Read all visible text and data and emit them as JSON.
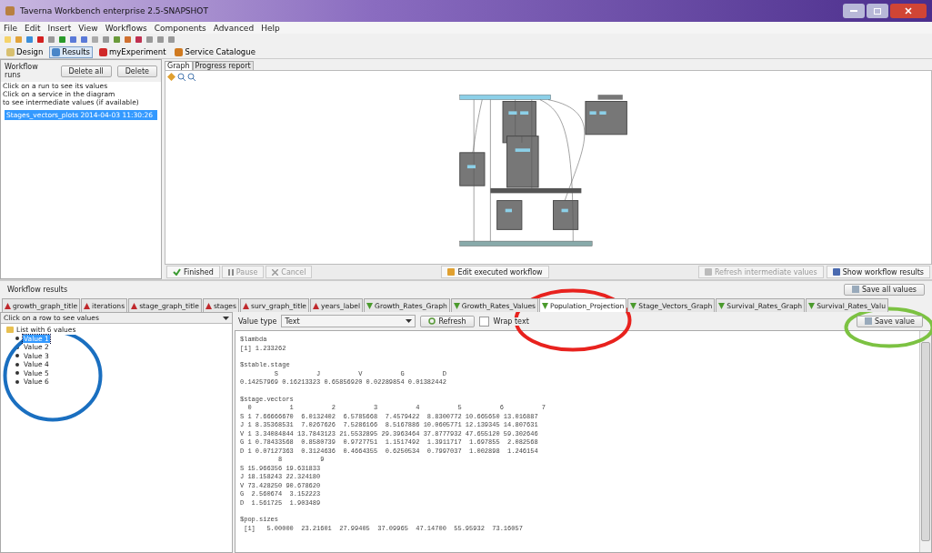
{
  "window": {
    "title": "Taverna Workbench enterprise 2.5-SNAPSHOT"
  },
  "menu": [
    "File",
    "Edit",
    "Insert",
    "View",
    "Workflows",
    "Components",
    "Advanced",
    "Help"
  ],
  "perspectives": [
    {
      "label": "Design",
      "selected": false
    },
    {
      "label": "Results",
      "selected": true
    },
    {
      "label": "myExperiment",
      "selected": false
    },
    {
      "label": "Service Catalogue",
      "selected": false
    }
  ],
  "runs_panel": {
    "title": "Workflow runs",
    "buttons": [
      "Delete all",
      "Delete"
    ],
    "hints": [
      "Click on a run to see its values",
      "Click on a service in the diagram",
      "to see intermediate values (if available)"
    ],
    "runs": [
      {
        "label": "Stages_vectors_plots 2014-04-03 11:30:26",
        "selected": true
      }
    ]
  },
  "graph_tabs": [
    {
      "label": "Graph",
      "selected": true
    },
    {
      "label": "Progress report",
      "selected": false
    }
  ],
  "run_controls": [
    {
      "label": "Finished",
      "kind": "status",
      "disabled": false
    },
    {
      "label": "Pause",
      "kind": "pause",
      "disabled": true
    },
    {
      "label": "Cancel",
      "kind": "cancel",
      "disabled": true
    }
  ],
  "graph_buttons": [
    {
      "label": "Edit executed workflow",
      "disabled": false
    },
    {
      "label": "Refresh intermediate values",
      "disabled": true
    },
    {
      "label": "Show workflow results",
      "disabled": false
    }
  ],
  "results": {
    "title": "Workflow results",
    "save_all": "Save all values",
    "ports": [
      {
        "label": "growth_graph_title",
        "kind": "input",
        "selected": false
      },
      {
        "label": "iterations",
        "kind": "input",
        "selected": false
      },
      {
        "label": "stage_graph_title",
        "kind": "input",
        "selected": false
      },
      {
        "label": "stages",
        "kind": "input",
        "selected": false
      },
      {
        "label": "surv_graph_title",
        "kind": "input",
        "selected": false
      },
      {
        "label": "years_label",
        "kind": "input",
        "selected": false
      },
      {
        "label": "Growth_Rates_Graph",
        "kind": "output",
        "selected": false
      },
      {
        "label": "Growth_Rates_Values",
        "kind": "output",
        "selected": false
      },
      {
        "label": "Population_Projection",
        "kind": "output",
        "selected": true
      },
      {
        "label": "Stage_Vectors_Graph",
        "kind": "output",
        "selected": false
      },
      {
        "label": "Survival_Rates_Graph",
        "kind": "output",
        "selected": false
      },
      {
        "label": "Survival_Rates_Valu",
        "kind": "output",
        "selected": false
      }
    ],
    "tree_header": "Click on a row to see values",
    "tree": {
      "label": "List with 6 values",
      "expanded": true,
      "children": [
        {
          "label": "Value 1",
          "selected": true
        },
        {
          "label": "Value 2",
          "selected": false
        },
        {
          "label": "Value 3",
          "selected": false
        },
        {
          "label": "Value 4",
          "selected": false
        },
        {
          "label": "Value 5",
          "selected": false
        },
        {
          "label": "Value 6",
          "selected": false
        }
      ]
    },
    "value_type_label": "Value type",
    "value_type": "Text",
    "refresh": "Refresh",
    "wrap_text": {
      "label": "Wrap text",
      "checked": false
    },
    "save_value": "Save value",
    "output_blocks": [
      [
        "$lambda",
        "[1] 1.233262"
      ],
      [
        "$stable.stage",
        "         S          J          V          G          D",
        "0.14257969 0.16213323 0.65856920 0.02289854 0.01382442"
      ],
      [
        "$stage.vectors",
        "  0          1          2          3          4          5          6          7",
        "S 1 7.66666670  6.0132402  6.5785668  7.4579422  8.8300772 10.665650 13.016887",
        "J 1 8.35368531  7.0267626  7.5286166  8.5167886 10.0605771 12.139345 14.807631",
        "V 1 3.34084844 13.7843123 21.5532895 29.3963464 37.8777932 47.655120 59.302646",
        "G 1 0.78433568  0.8580739  0.9727751  1.1517492  1.3911717  1.697855  2.082568",
        "D 1 0.07127363  0.3124636  0.4664355  0.6250534  0.7997037  1.002898  1.246154",
        "          8          9",
        "S 15.966356 19.631833",
        "J 18.158243 22.324180",
        "V 73.428250 90.678620",
        "G  2.560674  3.152223",
        "D  1.561725  1.903489"
      ],
      [
        "$pop.sizes",
        " [1]   5.00000  23.21601  27.99405  37.09965  47.14700  55.95932  73.16057"
      ]
    ]
  },
  "annotations": [
    {
      "color": "#e8221e"
    },
    {
      "color": "#1a6fc0"
    },
    {
      "color": "#7cc242"
    }
  ]
}
